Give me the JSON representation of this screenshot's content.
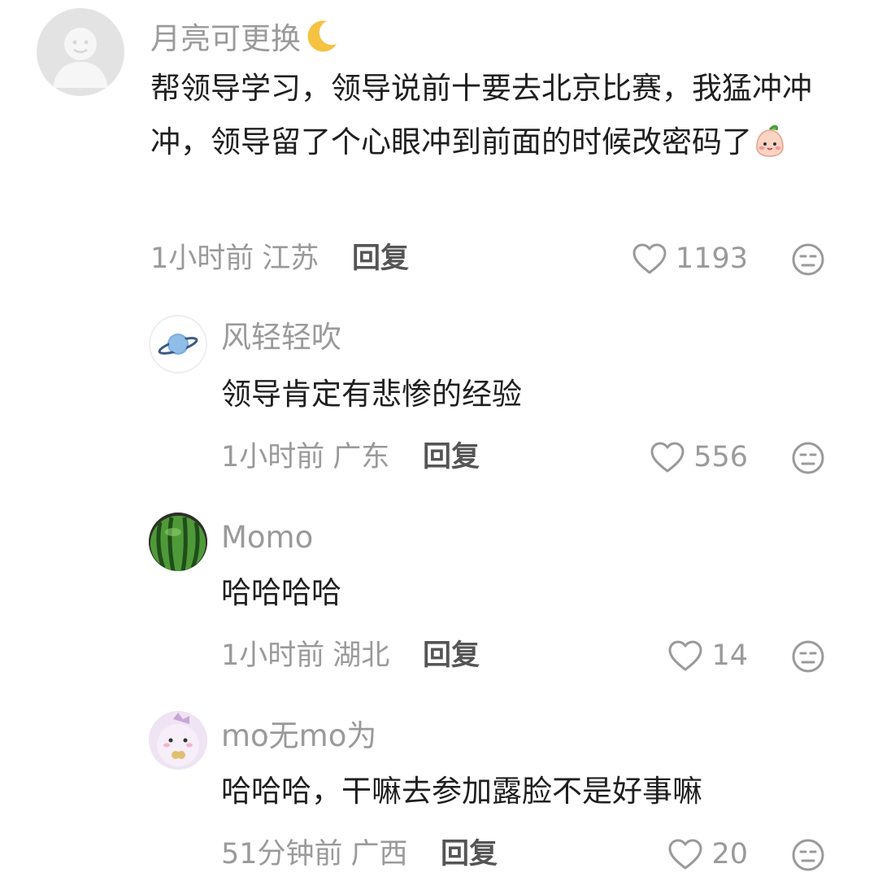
{
  "comments": [
    {
      "username": "月亮可更换",
      "username_emoji": "crescent-moon-icon",
      "text": "帮领导学习，领导说前十要去北京比赛，我猛冲冲冲，领导留了个心眼冲到前面的时候改密码了",
      "text_emoji": "blushing-peach-icon",
      "time": "1小时前",
      "location": "江苏",
      "reply_label": "回复",
      "likes": "1193"
    },
    {
      "username": "风轻轻吹",
      "text": "领导肯定有悲惨的经验",
      "time": "1小时前",
      "location": "广东",
      "reply_label": "回复",
      "likes": "556"
    },
    {
      "username": "Momo",
      "text": "哈哈哈哈",
      "time": "1小时前",
      "location": "湖北",
      "reply_label": "回复",
      "likes": "14"
    },
    {
      "username": "mo无mo为",
      "text": "哈哈哈，干嘛去参加露脸不是好事嘛",
      "time": "51分钟前",
      "location": "广西",
      "reply_label": "回复",
      "likes": "20"
    }
  ],
  "colors": {
    "secondary_text": "#9a9a9a",
    "primary_text": "#1f1f1f",
    "reply_text": "#555555"
  }
}
